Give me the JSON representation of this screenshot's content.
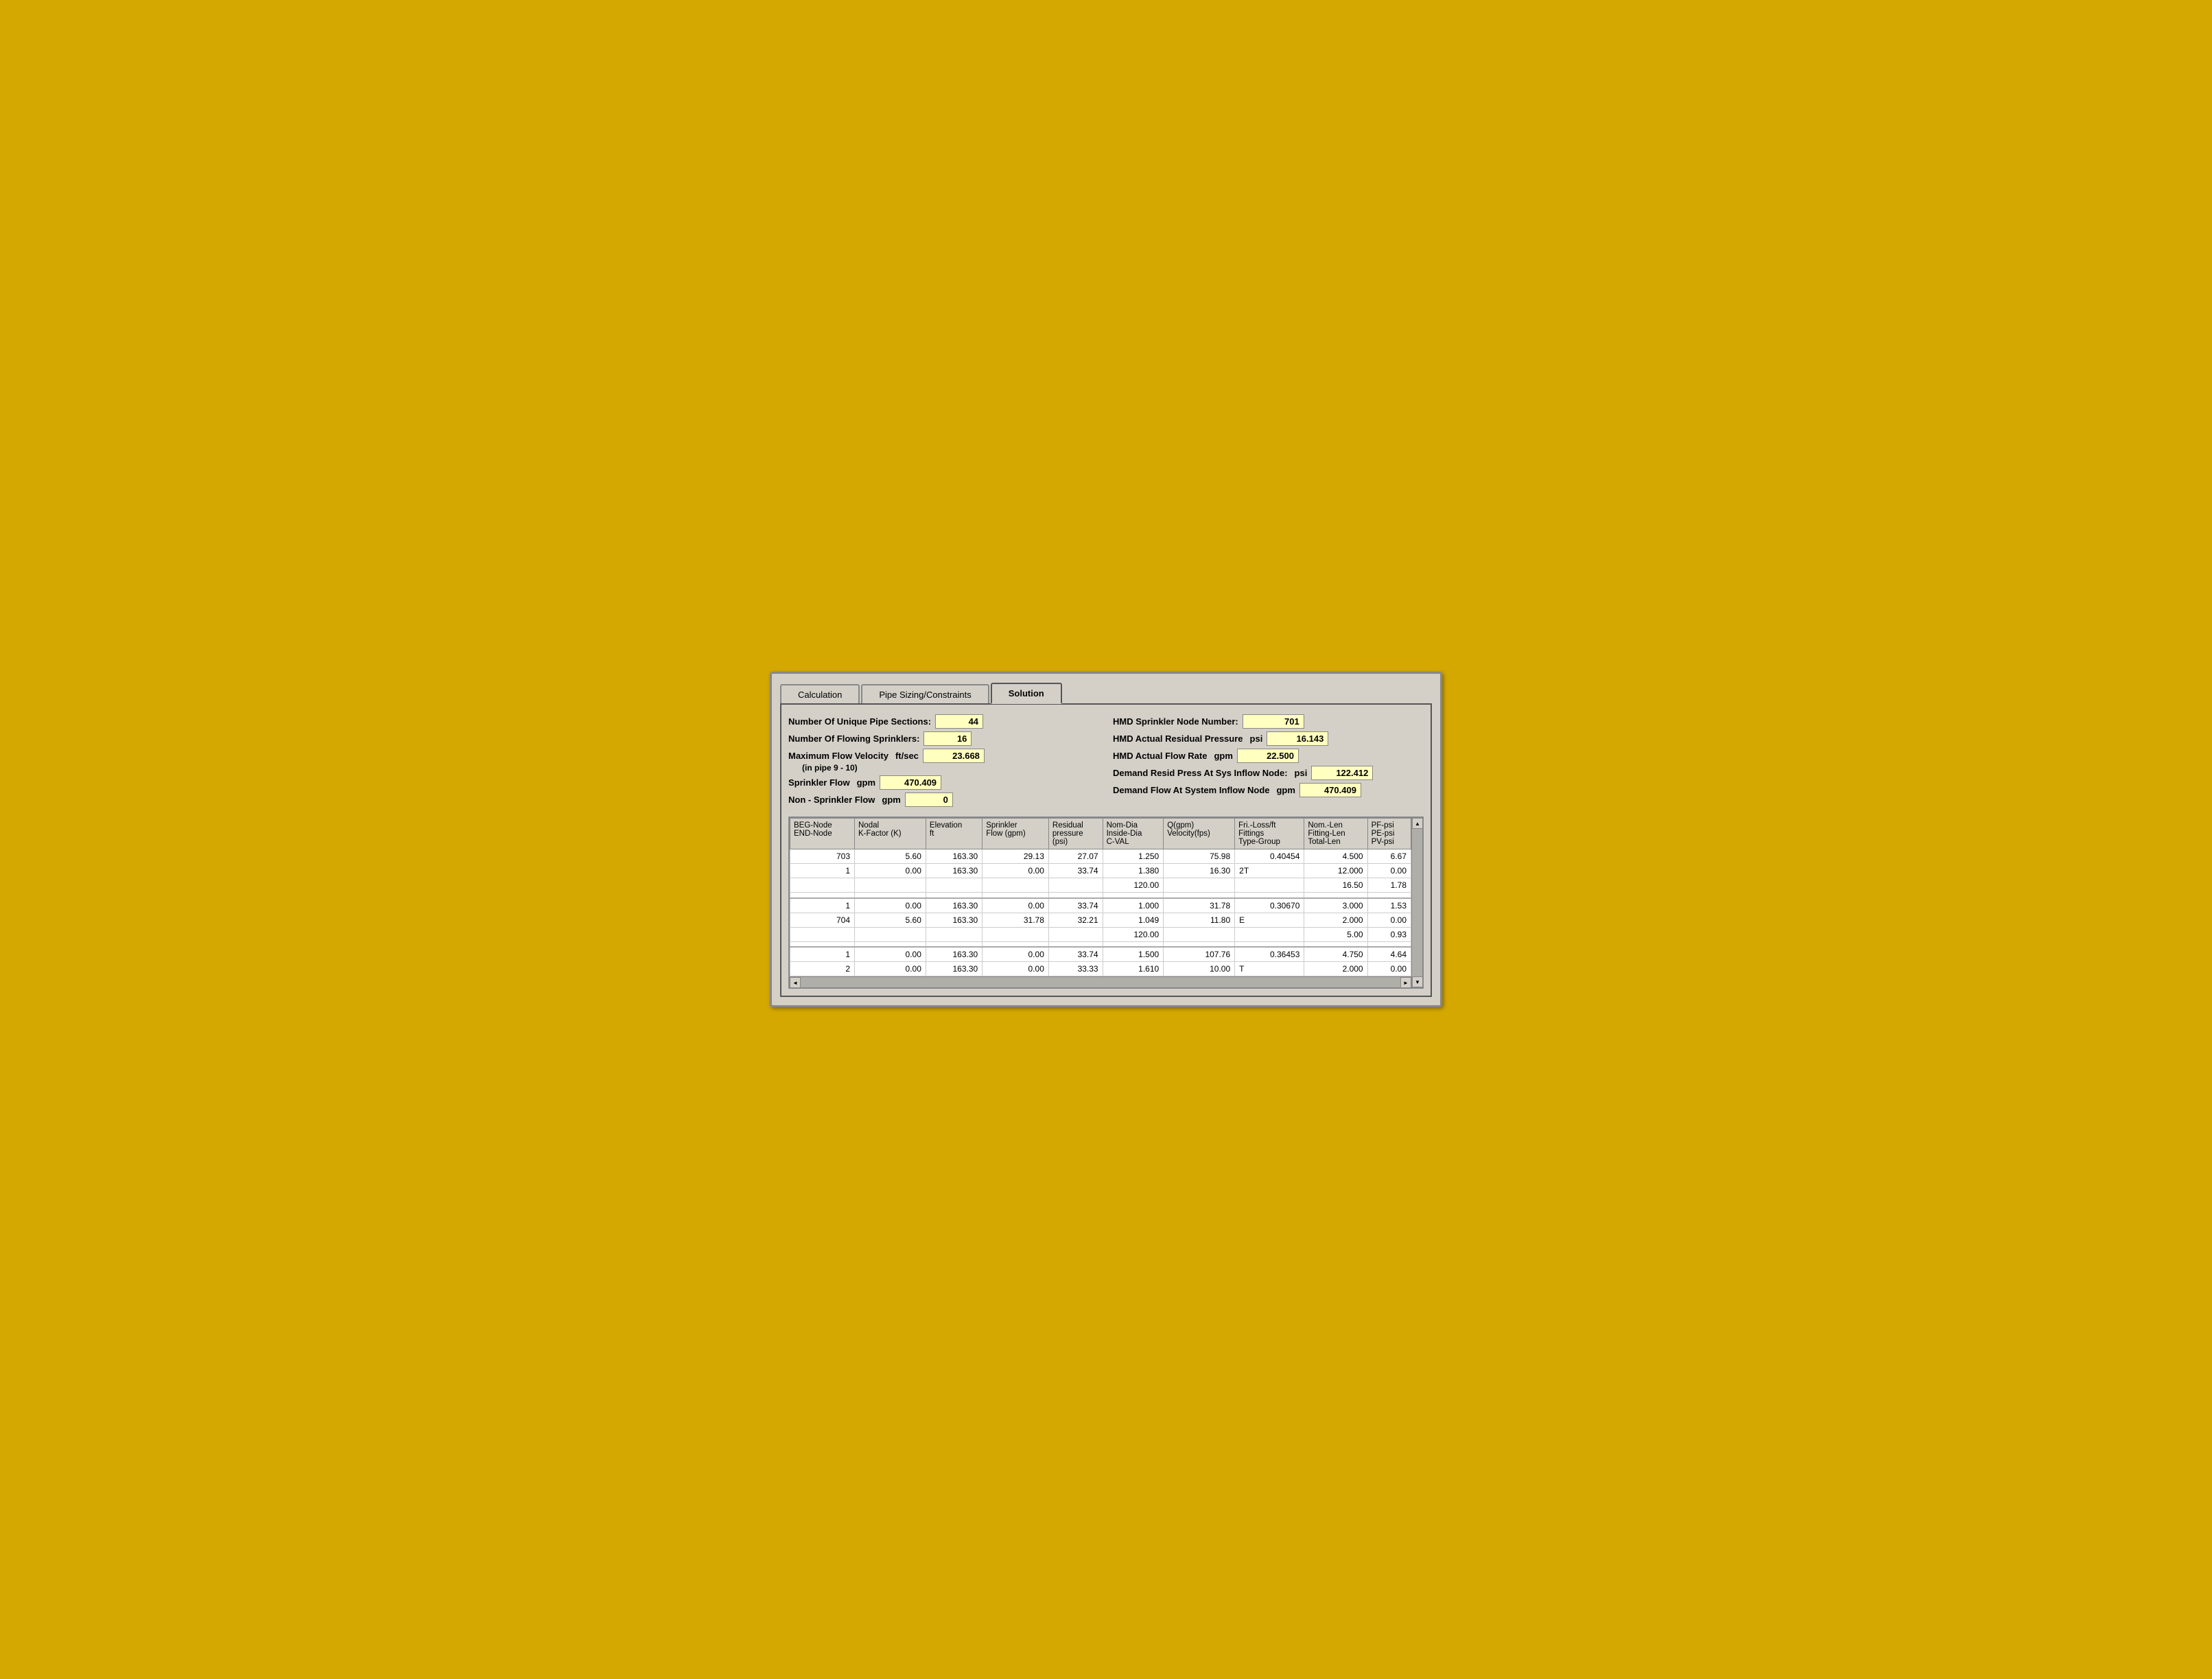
{
  "tabs": [
    {
      "id": "calculation",
      "label": "Calculation",
      "active": false
    },
    {
      "id": "pipe-sizing",
      "label": "Pipe Sizing/Constraints",
      "active": false
    },
    {
      "id": "solution",
      "label": "Solution",
      "active": true
    }
  ],
  "summary": {
    "left": [
      {
        "id": "unique-pipe",
        "label": "Number Of Unique Pipe Sections:",
        "value": "44",
        "unit": ""
      },
      {
        "id": "flowing-sprinklers",
        "label": "Number Of Flowing Sprinklers:",
        "value": "16",
        "unit": ""
      },
      {
        "id": "max-flow-velocity",
        "label": "Maximum Flow Velocity",
        "unit": "ft/sec",
        "value": "23.668",
        "sublabel": "(in pipe 9 - 10)"
      },
      {
        "id": "sprinkler-flow",
        "label": "Sprinkler Flow",
        "unit": "gpm",
        "value": "470.409"
      },
      {
        "id": "non-sprinkler-flow",
        "label": "Non - Sprinkler Flow",
        "unit": "gpm",
        "value": "0"
      }
    ],
    "right": [
      {
        "id": "hmd-node",
        "label": "HMD Sprinkler Node Number:",
        "value": "701",
        "unit": ""
      },
      {
        "id": "hmd-residual",
        "label": "HMD Actual Residual Pressure",
        "unit": "psi",
        "value": "16.143"
      },
      {
        "id": "hmd-flow",
        "label": "HMD Actual Flow Rate",
        "unit": "gpm",
        "value": "22.500"
      },
      {
        "id": "demand-resid",
        "label": "Demand Resid Press At Sys Inflow Node:",
        "unit": "psi",
        "value": "122.412"
      },
      {
        "id": "demand-flow",
        "label": "Demand Flow At System Inflow Node",
        "unit": "gpm",
        "value": "470.409"
      }
    ]
  },
  "table": {
    "headers": [
      "BEG-Node\nEND-Node",
      "Nodal\nK-Factor (K)",
      "Elevation\nft",
      "Sprinkler\nFlow (gpm)",
      "Residual\npressure\n(psi)",
      "Nom-Dia\nInside-Dia\nC-VAL",
      "Q(gpm)\nVelocity(fps)",
      "Fri.-Loss/ft\nFittings\nType-Group",
      "Nom.-Len\nFitting-Len\nTotal-Len",
      "PF-psi\nPE-psi\nPV-psi"
    ],
    "rows": [
      [
        "703",
        "5.60",
        "163.30",
        "29.13",
        "27.07",
        "1.250",
        "75.98",
        "0.40454",
        "4.500",
        "6.67"
      ],
      [
        "1",
        "0.00",
        "163.30",
        "0.00",
        "33.74",
        "1.380",
        "16.30",
        "2T",
        "12.000",
        "0.00"
      ],
      [
        "",
        "",
        "",
        "",
        "",
        "120.00",
        "",
        "",
        "16.50",
        "1.78"
      ],
      [
        "",
        "",
        "",
        "",
        "",
        "",
        "",
        "",
        "",
        ""
      ],
      [
        "1",
        "0.00",
        "163.30",
        "0.00",
        "33.74",
        "1.000",
        "31.78",
        "0.30670",
        "3.000",
        "1.53"
      ],
      [
        "704",
        "5.60",
        "163.30",
        "31.78",
        "32.21",
        "1.049",
        "11.80",
        "E",
        "2.000",
        "0.00"
      ],
      [
        "",
        "",
        "",
        "",
        "",
        "120.00",
        "",
        "",
        "5.00",
        "0.93"
      ],
      [
        "",
        "",
        "",
        "",
        "",
        "",
        "",
        "",
        "",
        ""
      ],
      [
        "1",
        "0.00",
        "163.30",
        "0.00",
        "33.74",
        "1.500",
        "107.76",
        "0.36453",
        "4.750",
        "4.64"
      ],
      [
        "2",
        "0.00",
        "163.30",
        "0.00",
        "33.33",
        "1.610",
        "10.00",
        "T",
        "2.000",
        "0.00"
      ]
    ]
  },
  "icons": {
    "scroll_up": "▲",
    "scroll_down": "▼",
    "scroll_left": "◄",
    "scroll_right": "►"
  }
}
